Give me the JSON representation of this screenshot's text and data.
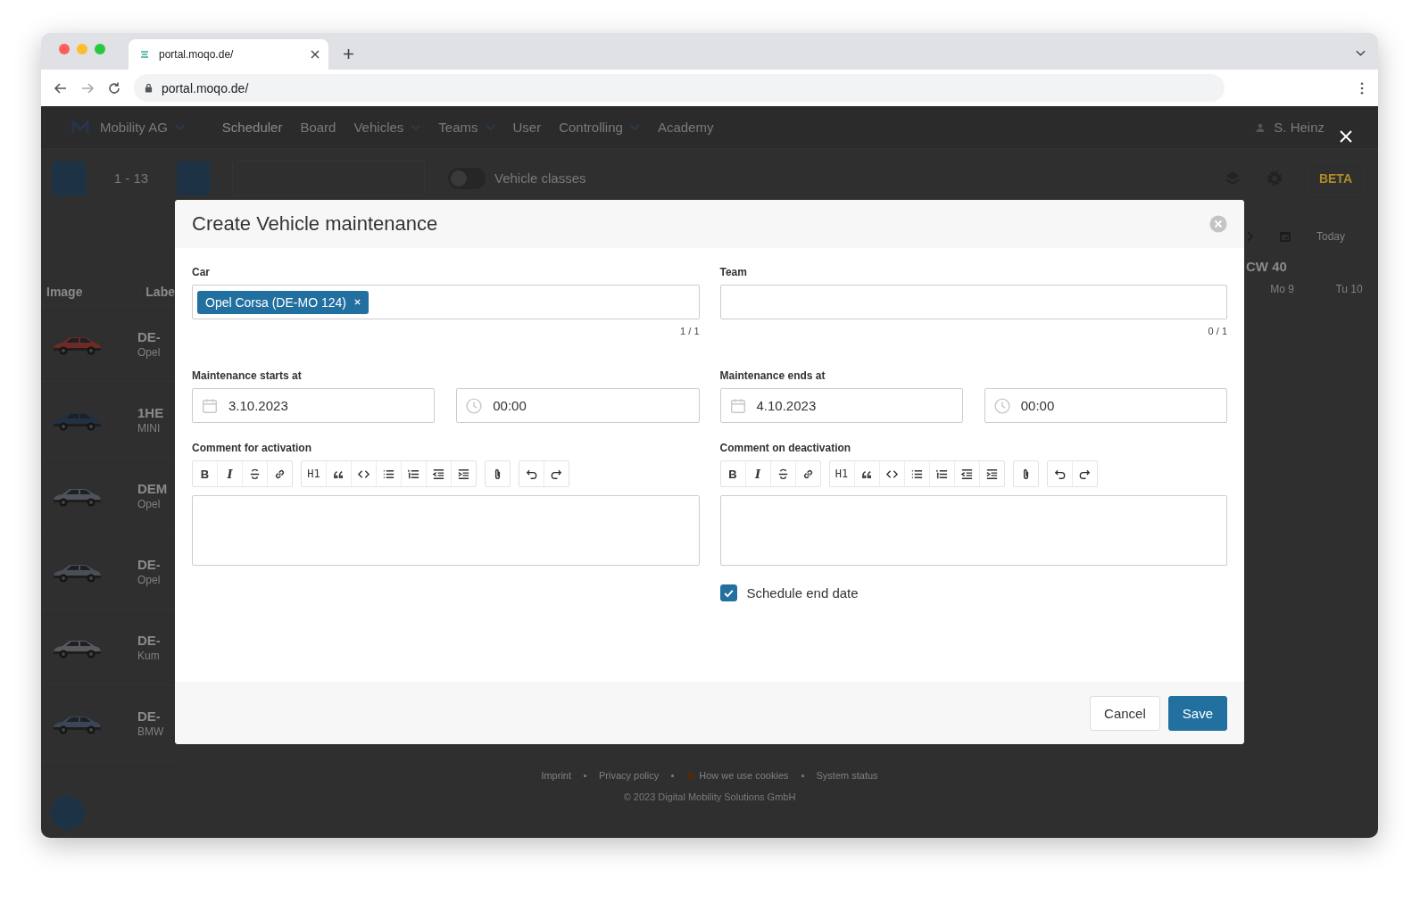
{
  "browser": {
    "tab_title": "portal.moqo.de/",
    "url": "portal.moqo.de/"
  },
  "nav": {
    "brand": "Mobility AG",
    "items": [
      {
        "label": "Scheduler",
        "selected": true,
        "dropdown": false
      },
      {
        "label": "Board",
        "selected": false,
        "dropdown": false
      },
      {
        "label": "Vehicles",
        "selected": false,
        "dropdown": true
      },
      {
        "label": "Teams",
        "selected": false,
        "dropdown": true
      },
      {
        "label": "User",
        "selected": false,
        "dropdown": false
      },
      {
        "label": "Controlling",
        "selected": false,
        "dropdown": true
      },
      {
        "label": "Academy",
        "selected": false,
        "dropdown": false
      }
    ],
    "user": "S. Heinz"
  },
  "toolbar": {
    "range": "1 - 13",
    "toggle_label": "Vehicle classes",
    "toggle_on": false,
    "badge": "BETA"
  },
  "vehicle_table": {
    "columns": [
      "Image",
      "Labe"
    ],
    "rows": [
      {
        "label": "DE-",
        "model": "Opel"
      },
      {
        "label": "1HE",
        "model": "MINI"
      },
      {
        "label": "DEM",
        "model": "Opel"
      },
      {
        "label": "DE-",
        "model": "Opel"
      },
      {
        "label": "DE-",
        "model": "Kum"
      },
      {
        "label": "DE-",
        "model": "BMW"
      }
    ]
  },
  "calendar": {
    "today": "Today",
    "week": "CW 40",
    "days": [
      "Mo 9",
      "Tu 10"
    ]
  },
  "footer": {
    "links": [
      "Imprint",
      "Privacy policy",
      "How we use cookies",
      "System status"
    ],
    "copyright": "© 2023 Digital Mobility Solutions GmbH"
  },
  "modal": {
    "title": "Create Vehicle maintenance",
    "car": {
      "label": "Car",
      "tags": [
        "Opel Corsa (DE-MO 124)"
      ],
      "count": "1 / 1"
    },
    "team": {
      "label": "Team",
      "count": "0 / 1"
    },
    "starts": {
      "label": "Maintenance starts at",
      "date": "3.10.2023",
      "time": "00:00"
    },
    "ends": {
      "label": "Maintenance ends at",
      "date": "4.10.2023",
      "time": "00:00"
    },
    "comments": [
      {
        "label": "Comment for activation",
        "tools": [
          [
            {
              "kind": "bold",
              "text": "B"
            },
            {
              "kind": "italic",
              "text": "I"
            },
            {
              "kind": "strike"
            },
            {
              "kind": "link"
            }
          ],
          [
            {
              "kind": "heading",
              "text": "H1"
            },
            {
              "kind": "quote"
            },
            {
              "kind": "code"
            },
            {
              "kind": "bullets"
            },
            {
              "kind": "numbers"
            },
            {
              "kind": "outdent"
            },
            {
              "kind": "indent"
            }
          ],
          [
            {
              "kind": "attach"
            }
          ],
          [
            {
              "kind": "undo"
            },
            {
              "kind": "redo"
            }
          ]
        ]
      },
      {
        "label": "Comment on deactivation",
        "tools": [
          [
            {
              "kind": "bold",
              "text": "B"
            },
            {
              "kind": "italic",
              "text": "I"
            },
            {
              "kind": "strike"
            },
            {
              "kind": "link"
            }
          ],
          [
            {
              "kind": "heading",
              "text": "H1"
            },
            {
              "kind": "quote"
            },
            {
              "kind": "code"
            },
            {
              "kind": "bullets"
            },
            {
              "kind": "numbers"
            },
            {
              "kind": "outdent"
            },
            {
              "kind": "indent"
            }
          ],
          [
            {
              "kind": "attach"
            }
          ],
          [
            {
              "kind": "undo"
            },
            {
              "kind": "redo"
            }
          ]
        ]
      }
    ],
    "schedule_end": {
      "label": "Schedule end date",
      "checked": true
    },
    "buttons": [
      {
        "kind": "secondary",
        "label": "Cancel"
      },
      {
        "kind": "primary",
        "label": "Save"
      }
    ]
  }
}
